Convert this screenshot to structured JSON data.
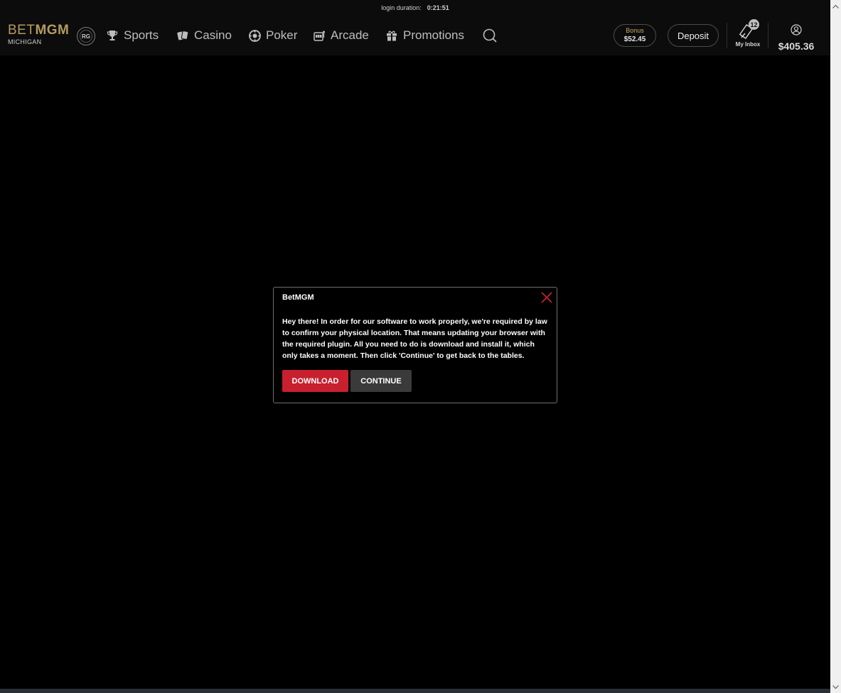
{
  "session": {
    "label": "login duration:",
    "time": "0:21:51"
  },
  "brand": {
    "bet": "BET",
    "mgm": "MGM",
    "state": "MICHIGAN",
    "rg": "RG"
  },
  "nav": {
    "sports": "Sports",
    "casino": "Casino",
    "poker": "Poker",
    "arcade": "Arcade",
    "promotions": "Promotions"
  },
  "header": {
    "bonus_label": "Bonus",
    "bonus_amount": "$52.45",
    "deposit": "Deposit",
    "inbox_label": "My Inbox",
    "inbox_count": "12",
    "balance": "$405.36"
  },
  "modal": {
    "title": "BetMGM",
    "message": "Hey there! In order for our software to work properly, we're required by law to confirm your physical location. That means updating your browser with the required plugin. All you need to do is download and install it, which only takes a moment. Then click 'Continue' to get back to the tables.",
    "download": "DOWNLOAD",
    "continue": "CONTINUE"
  },
  "colors": {
    "brand_gold": "#b59a5e",
    "download_red": "#c8202e",
    "close_red": "#d0212f",
    "background": "#000000"
  }
}
